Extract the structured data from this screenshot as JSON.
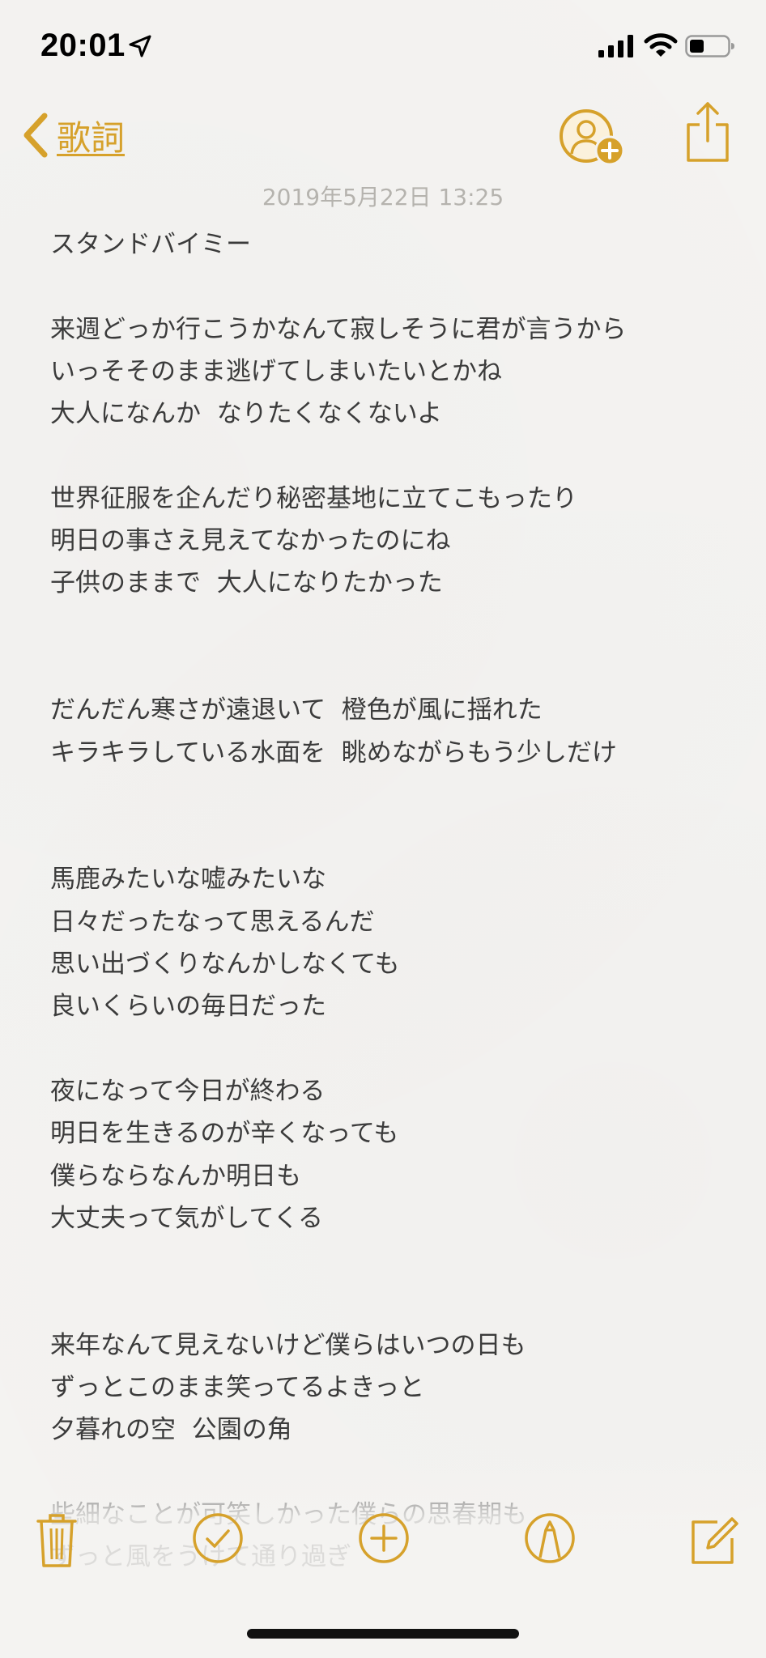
{
  "status_bar": {
    "time": "20:01"
  },
  "nav": {
    "back_label": "歌詞"
  },
  "note": {
    "date": "2019年5月22日 13:25",
    "lines": [
      "スタンドバイミー",
      "",
      "来週どっか行こうかなんて寂しそうに君が言うから",
      "いっそそのまま逃げてしまいたいとかね",
      "大人になんか  なりたくなくないよ",
      "",
      "世界征服を企んだり秘密基地に立てこもったり",
      "明日の事さえ見えてなかったのにね",
      "子供のままで  大人になりたかった",
      "",
      "",
      "だんだん寒さが遠退いて  橙色が風に揺れた",
      "キラキラしている水面を  眺めながらもう少しだけ",
      "",
      "",
      "馬鹿みたいな嘘みたいな",
      "日々だったなって思えるんだ",
      "思い出づくりなんかしなくても",
      "良いくらいの毎日だった",
      "",
      "夜になって今日が終わる",
      "明日を生きるのが辛くなっても",
      "僕らならなんか明日も",
      "大丈夫って気がしてくる",
      "",
      "",
      "来年なんて見えないけど僕らはいつの日も",
      "ずっとこのまま笑ってるよきっと",
      "夕暮れの空  公園の角",
      "",
      "些細なことが可笑しかった僕らの思春期も",
      "ずっと風をうけて通り過ぎ"
    ]
  },
  "colors": {
    "accent": "#d6a12b",
    "text": "#3b3b3b",
    "date": "#b5b3ae",
    "background": "#f4f3f1"
  },
  "icons": {
    "back": "chevron-left-icon",
    "add_person": "add-person-icon",
    "share": "share-icon",
    "trash": "trash-icon",
    "checklist": "checkmark-circle-icon",
    "add": "plus-circle-icon",
    "markup": "pen-circle-icon",
    "compose": "compose-icon"
  }
}
